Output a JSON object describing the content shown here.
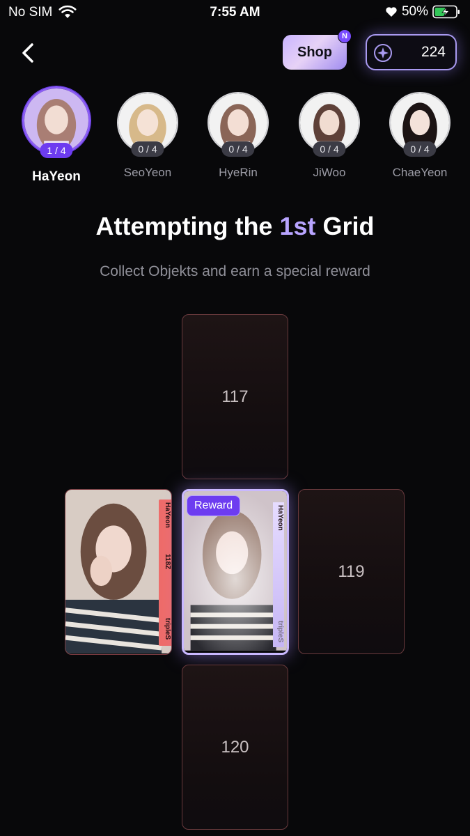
{
  "status_bar": {
    "carrier": "No SIM",
    "time": "7:55 AM",
    "battery": "50%"
  },
  "header": {
    "back_icon": "chevron-left-icon",
    "shop_label": "Shop",
    "shop_badge": "N",
    "balance": "224",
    "balance_icon": "compass-star-icon"
  },
  "members": [
    {
      "name": "HaYeon",
      "count": "1 / 4",
      "active": true
    },
    {
      "name": "SeoYeon",
      "count": "0 / 4",
      "active": false
    },
    {
      "name": "HyeRin",
      "count": "0 / 4",
      "active": false
    },
    {
      "name": "JiWoo",
      "count": "0 / 4",
      "active": false
    },
    {
      "name": "ChaeYeon",
      "count": "0 / 4",
      "active": false
    }
  ],
  "grid": {
    "title_prefix": "Attempting the ",
    "title_accent": "1st",
    "title_suffix": " Grid",
    "subtitle": "Collect Objekts and earn a special reward",
    "slot_top": "117",
    "slot_right": "119",
    "slot_bottom": "120",
    "collected_card": {
      "member": "HaYeon",
      "number": "118Z",
      "brand": "tripleS"
    },
    "reward_card": {
      "badge": "Reward",
      "member": "HaYeon",
      "brand": "tripleS"
    }
  },
  "colors": {
    "accent": "#8b5cf6",
    "background": "#08080a",
    "card_band": "#ee6c6a"
  }
}
